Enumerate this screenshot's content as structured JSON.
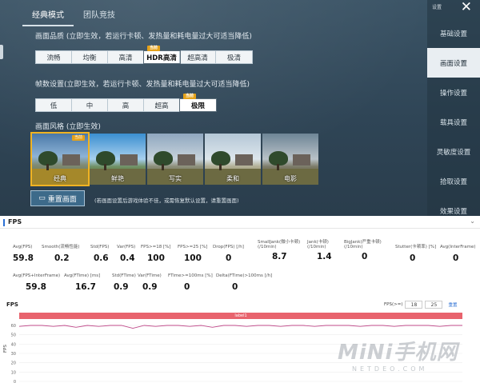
{
  "game": {
    "tabs": [
      "经典模式",
      "团队竞技"
    ],
    "quality": {
      "label": "画面品质 (立即生效，若运行卡顿、发热量和耗电量过大可适当降低)",
      "options": [
        "流畅",
        "均衡",
        "高清",
        "HDR高清",
        "超高清",
        "极清"
      ],
      "selected": "HDR高清",
      "badge": "当前"
    },
    "fps": {
      "label": "帧数设置(立即生效，若运行卡顿、发热量和耗电量过大可适当降低)",
      "options": [
        "低",
        "中",
        "高",
        "超高",
        "极限"
      ],
      "selected": "极限",
      "badge": "当前"
    },
    "style": {
      "label": "画面风格 (立即生效)",
      "options": [
        "经典",
        "鲜艳",
        "写实",
        "柔和",
        "电影"
      ],
      "selected": "经典",
      "badge": "当前"
    },
    "reset_label": "重置画面",
    "reset_note": "(若画面设置后游戏体验不佳，或需恢复默认设置，请重置画面)",
    "sidebar": {
      "top_label": "设置",
      "items": [
        "基础设置",
        "画面设置",
        "操作设置",
        "载具设置",
        "灵敏度设置",
        "拾取设置",
        "效果设置"
      ],
      "active": "画面设置"
    }
  },
  "report": {
    "title": "FPS",
    "metrics_row1": [
      {
        "label": "Avg(FPS)",
        "value": "59.8"
      },
      {
        "label": "Smooth(流畅性能)",
        "value": "0.2"
      },
      {
        "label": "Std(FPS)",
        "value": "0.6"
      },
      {
        "label": "Var(FPS)",
        "value": "0.4"
      },
      {
        "label": "FPS>=18 [%]",
        "value": "100"
      },
      {
        "label": "FPS>=25 [%]",
        "value": "100"
      },
      {
        "label": "Drop(FPS) [/h]",
        "value": "0"
      },
      {
        "label": "SmallJank(微小卡顿) (/10min)",
        "value": "8.7"
      },
      {
        "label": "Jank(卡顿) (/10min)",
        "value": "1.4"
      },
      {
        "label": "BigJank(严重卡顿) (/10min)",
        "value": "0"
      },
      {
        "label": "Stutter(卡顿率) [%]",
        "value": "0"
      },
      {
        "label": "Avg(InterFrame)",
        "value": "0"
      }
    ],
    "metrics_row2": [
      {
        "label": "Avg(FPS+InterFrame)",
        "value": "59.8"
      },
      {
        "label": "Avg(FTime) [ms]",
        "value": "16.7"
      },
      {
        "label": "Std(FTime)",
        "value": "0.9"
      },
      {
        "label": "Var(FTime)",
        "value": "0.9"
      },
      {
        "label": "FTime>=100ms [%]",
        "value": "0"
      },
      {
        "label": "Delta(FTime)>100ms [/h]",
        "value": "0"
      }
    ],
    "chart_label": "FPS",
    "range_label": "FPS(>=)",
    "range_values": [
      "18",
      "25"
    ],
    "range_reset": "重置",
    "legend": "label1"
  },
  "watermark": {
    "main": "MiNi手机网",
    "sub": "NETDEO.COM"
  },
  "colors": {
    "accent": "#f0b323",
    "panel": "#2f4556",
    "legend": "#e8636d",
    "line": "#c04a8a"
  },
  "chart_data": {
    "type": "line",
    "ylabel": "FPS",
    "yticks": [
      60,
      50,
      40,
      30,
      20,
      10,
      0
    ],
    "series": [
      {
        "name": "label1",
        "values": [
          59,
          60,
          60,
          59,
          60,
          58,
          60,
          59,
          60,
          60,
          57,
          60,
          59,
          60,
          60,
          59,
          60,
          58,
          60,
          60,
          59,
          60,
          60,
          59,
          60,
          60,
          59,
          60,
          60,
          60,
          59,
          60,
          60,
          59,
          60,
          60,
          60,
          59,
          60,
          60
        ]
      }
    ]
  }
}
